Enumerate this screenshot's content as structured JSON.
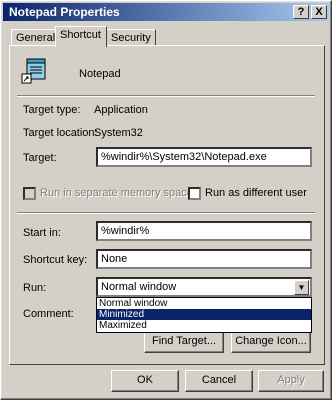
{
  "window": {
    "title": "Notepad Properties",
    "help_btn": "?",
    "close_btn": "X"
  },
  "tabs": [
    {
      "label": "General"
    },
    {
      "label": "Shortcut"
    },
    {
      "label": "Security"
    }
  ],
  "shortcut": {
    "name": "Notepad",
    "target_type_label": "Target type:",
    "target_type_value": "Application",
    "target_location_label": "Target location:",
    "target_location_value": "System32",
    "target_label": "Target:",
    "target_value": "%windir%\\System32\\Notepad.exe",
    "run_separate_label": "Run in separate memory space",
    "run_as_label": "Run as different user",
    "start_in_label": "Start in:",
    "start_in_value": "%windir%",
    "shortcut_key_label": "Shortcut key:",
    "shortcut_key_value": "None",
    "run_label": "Run:",
    "run_value": "Normal window",
    "run_options": [
      "Normal window",
      "Minimized",
      "Maximized"
    ],
    "comment_label": "Comment:",
    "find_target_label": "Find Target...",
    "change_icon_label": "Change Icon..."
  },
  "buttons": {
    "ok": "OK",
    "cancel": "Cancel",
    "apply": "Apply"
  }
}
